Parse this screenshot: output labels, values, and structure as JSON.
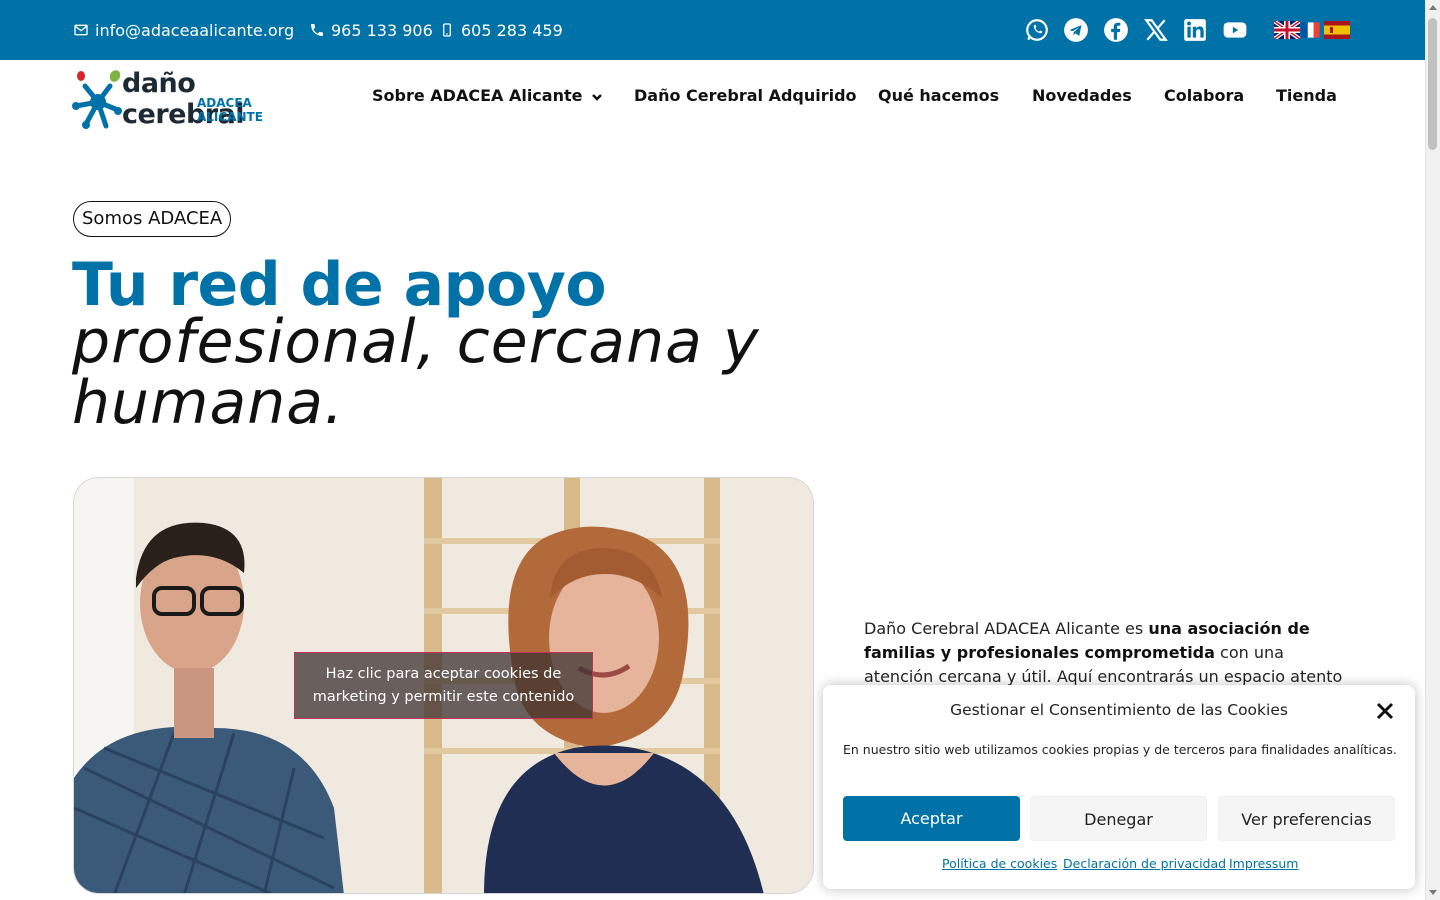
{
  "topbar": {
    "email": "info@adaceaalicante.org",
    "phone1": "965 133 906",
    "phone2": "605 283 459",
    "social_icons": [
      "whatsapp-icon",
      "telegram-icon",
      "facebook-icon",
      "x-icon",
      "linkedin-icon",
      "youtube-icon"
    ],
    "languages": [
      "en-flag",
      "fr-flag",
      "es-flag"
    ],
    "bg_color": "#0072a8"
  },
  "header": {
    "logo_name": "daño cerebral",
    "logo_sub": "ADACEA ALICANTE",
    "nav": [
      {
        "label": "Sobre ADACEA Alicante",
        "has_dropdown": true
      },
      {
        "label": "Daño Cerebral Adquirido"
      },
      {
        "label": "Qué hacemos"
      },
      {
        "label": "Novedades"
      },
      {
        "label": "Colabora"
      },
      {
        "label": "Tienda"
      }
    ]
  },
  "hero": {
    "pill": "Somos ADACEA",
    "title_strong": "Tu red de apoyo",
    "title_italic": "profesional, cercana y humana.",
    "accent_color": "#0072a8"
  },
  "video": {
    "cookie_overlay_text": "Haz clic para aceptar cookies de marketing y permitir este contenido"
  },
  "description": {
    "part1": "Daño Cerebral ADACEA Alicante es ",
    "bold": "una asociación de familias y profesionales comprometida",
    "part2": " con una atención cercana y útil. Aquí encontrarás un espacio atento para"
  },
  "cookie_banner": {
    "title": "Gestionar el Consentimiento de las Cookies",
    "text": "En nuestro sitio web utilizamos cookies propias y de terceros para finalidades analíticas.",
    "accept": "Aceptar",
    "deny": "Denegar",
    "preferences": "Ver preferencias",
    "links": [
      "Política de cookies",
      "Declaración de privacidad",
      "Impressum"
    ]
  }
}
